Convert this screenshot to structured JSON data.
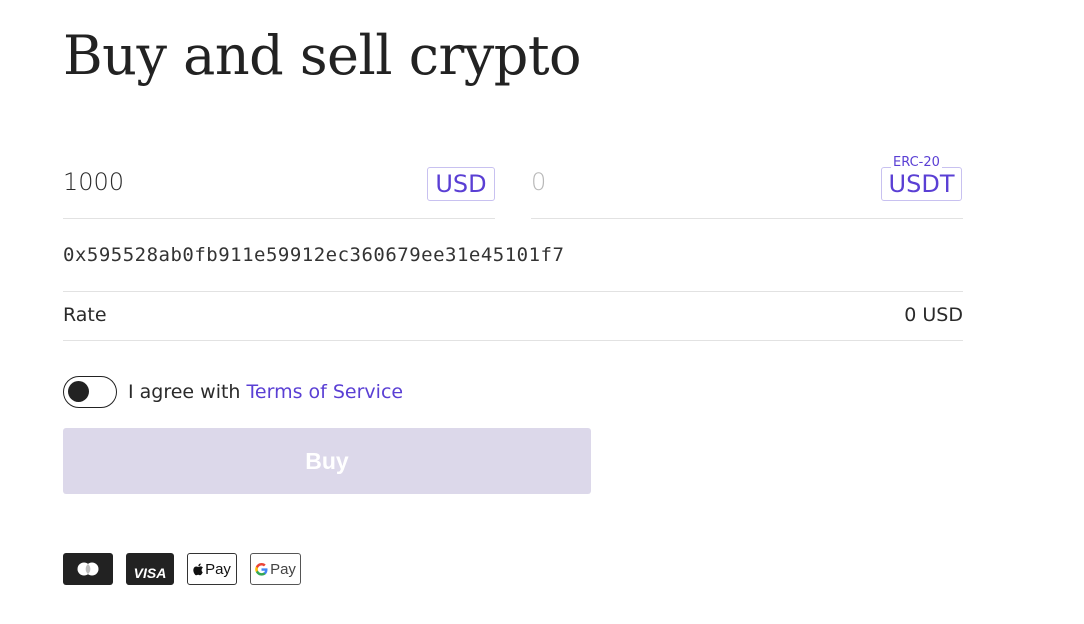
{
  "page": {
    "title": "Buy and sell crypto"
  },
  "from": {
    "amount": "1000",
    "currency": "USD"
  },
  "to": {
    "amount_placeholder": "0",
    "currency": "USDT",
    "network": "ERC-20"
  },
  "wallet_address": "0x595528ab0fb911e59912ec360679ee31e45101f7",
  "rate": {
    "label": "Rate",
    "value": "0 USD"
  },
  "agreement": {
    "text": "I agree with",
    "link_text": "Terms of Service",
    "checked": false
  },
  "buy_button": {
    "label": "Buy",
    "enabled": false
  },
  "payment_methods": [
    {
      "name": "mastercard",
      "label": ""
    },
    {
      "name": "visa",
      "label": "VISA"
    },
    {
      "name": "apple-pay",
      "label": "Pay"
    },
    {
      "name": "google-pay",
      "label": "Pay"
    }
  ],
  "colors": {
    "accent": "#5a3fd4",
    "button_disabled": "#dcd8ea",
    "text": "#222222",
    "divider": "#e2e2e2"
  }
}
